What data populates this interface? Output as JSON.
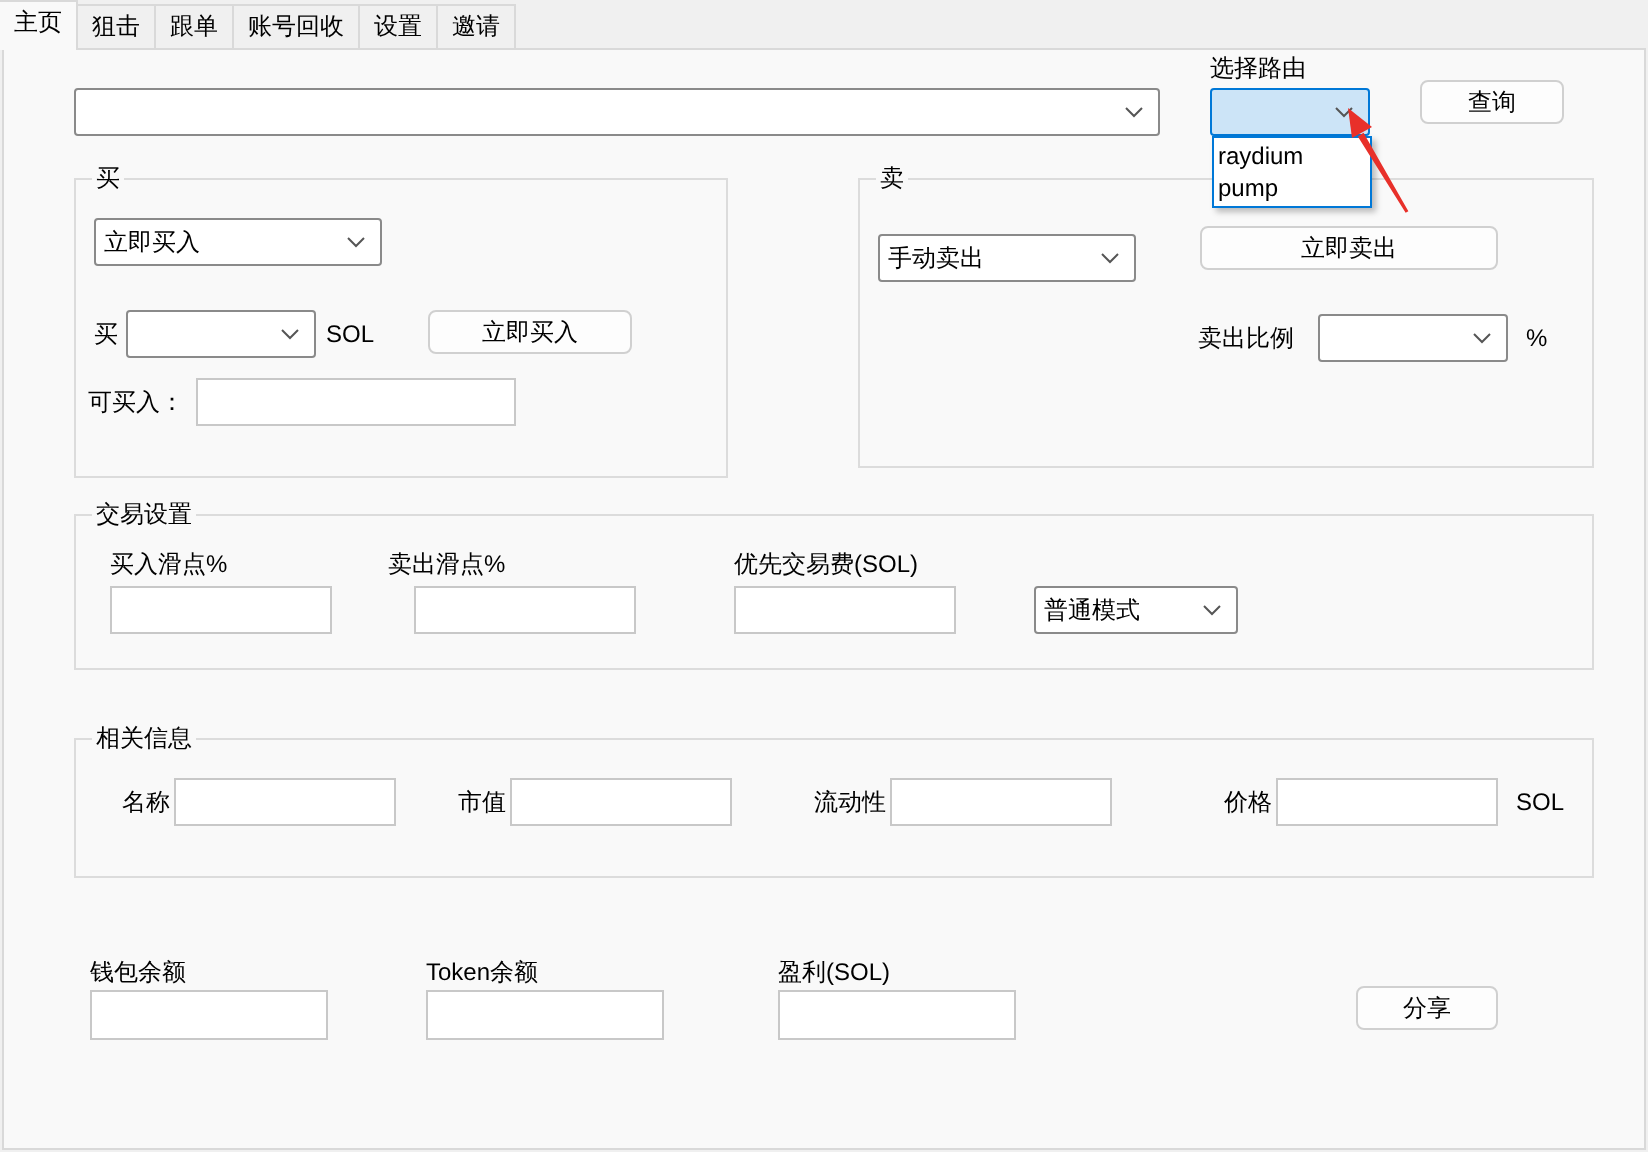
{
  "tabs": [
    {
      "label": "主页",
      "selected": true
    },
    {
      "label": "狙击",
      "selected": false
    },
    {
      "label": "跟单",
      "selected": false
    },
    {
      "label": "账号回收",
      "selected": false
    },
    {
      "label": "设置",
      "selected": false
    },
    {
      "label": "邀请",
      "selected": false
    }
  ],
  "route": {
    "label": "选择路由",
    "expanded": true,
    "options": [
      {
        "label": "raydium",
        "selected": false
      },
      {
        "label": "pump",
        "selected": false
      }
    ]
  },
  "query_button": "查询",
  "buy": {
    "title": "买",
    "mode": "立即买入",
    "amount_label": "买",
    "unit": "SOL",
    "button": "立即买入",
    "available_label": "可买入："
  },
  "sell": {
    "title": "卖",
    "mode": "手动卖出",
    "button": "立即卖出",
    "ratio_label": "卖出比例",
    "unit": "%"
  },
  "trade_settings": {
    "title": "交易设置",
    "fields": [
      {
        "label": "买入滑点%"
      },
      {
        "label": "卖出滑点%"
      },
      {
        "label": "优先交易费(SOL)"
      }
    ],
    "mode": "普通模式"
  },
  "info": {
    "title": "相关信息",
    "fields": [
      {
        "label": "名称"
      },
      {
        "label": "市值"
      },
      {
        "label": "流动性"
      },
      {
        "label": "价格",
        "unit": "SOL"
      }
    ]
  },
  "summary": {
    "fields": [
      {
        "label": "钱包余额"
      },
      {
        "label": "Token余额"
      },
      {
        "label": "盈利(SOL)"
      }
    ],
    "share_button": "分享"
  }
}
